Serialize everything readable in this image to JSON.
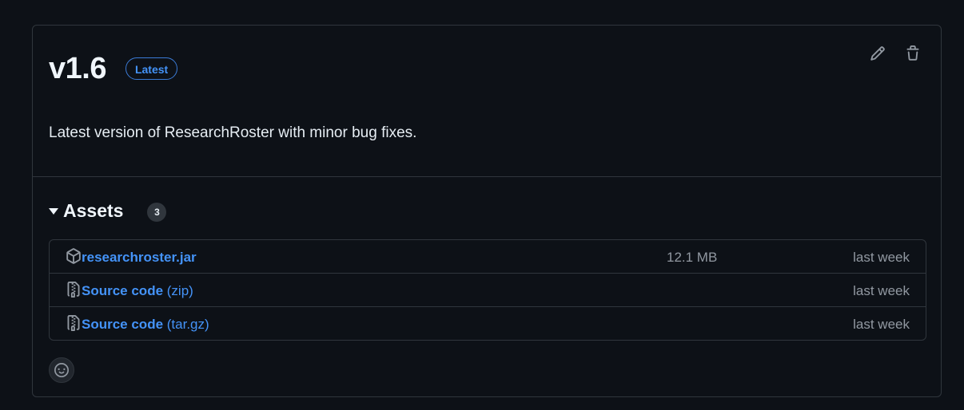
{
  "release": {
    "title": "v1.6",
    "badge": "Latest",
    "description": "Latest version of ResearchRoster with minor bug fixes.",
    "actions": {
      "edit_icon": "pencil-icon",
      "delete_icon": "trash-icon"
    }
  },
  "assets": {
    "title": "Assets",
    "count": "3",
    "items": [
      {
        "icon": "package-icon",
        "name": "researchroster.jar",
        "suffix": "",
        "size": "12.1 MB",
        "date": "last week"
      },
      {
        "icon": "file-zip-icon",
        "name": "Source code",
        "suffix": " (zip)",
        "size": "",
        "date": "last week"
      },
      {
        "icon": "file-zip-icon",
        "name": "Source code",
        "suffix": " (tar.gz)",
        "size": "",
        "date": "last week"
      }
    ]
  },
  "reactions": {
    "icon": "smiley-icon"
  },
  "colors": {
    "background": "#0d1117",
    "border": "#30363d",
    "link": "#4493f8",
    "muted": "#9198a1",
    "text": "#e6edf3"
  }
}
